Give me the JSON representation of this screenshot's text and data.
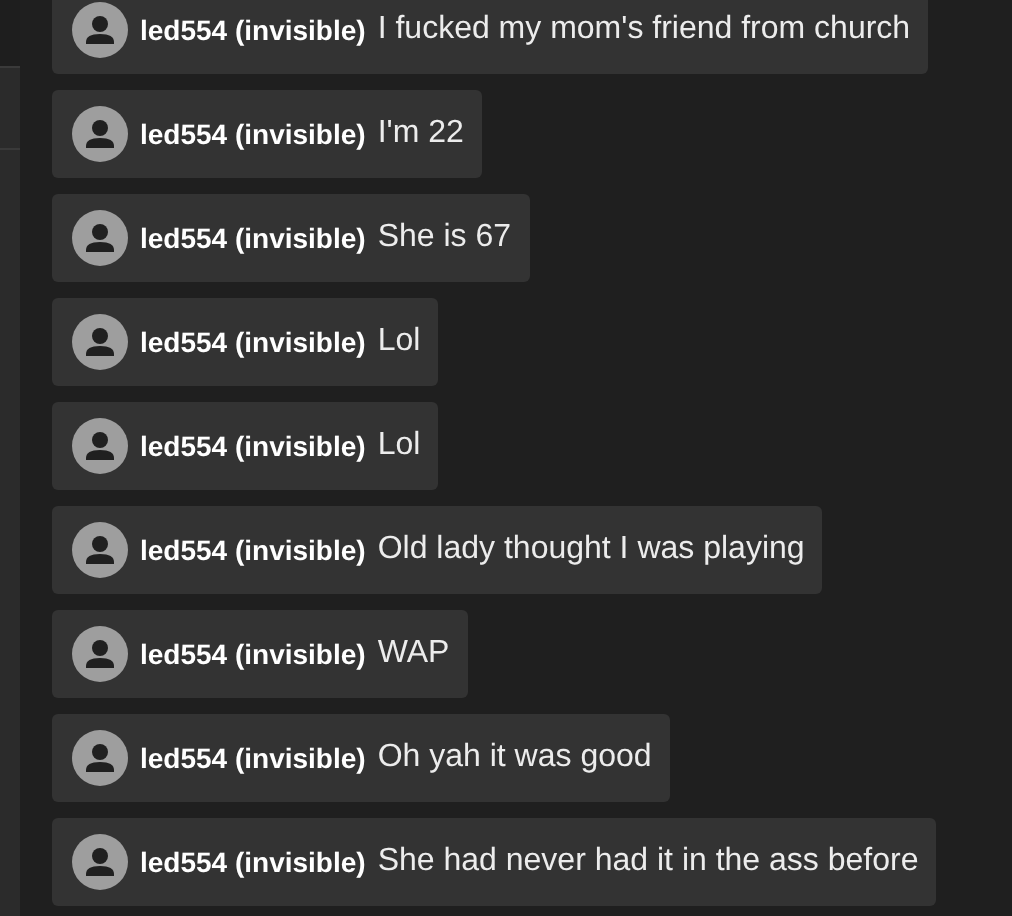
{
  "messages": [
    {
      "username": "led554 (invisible)",
      "text": "I fucked my mom's friend from church"
    },
    {
      "username": "led554 (invisible)",
      "text": "I'm 22"
    },
    {
      "username": "led554 (invisible)",
      "text": "She is 67"
    },
    {
      "username": "led554 (invisible)",
      "text": "Lol"
    },
    {
      "username": "led554 (invisible)",
      "text": "Lol"
    },
    {
      "username": "led554 (invisible)",
      "text": "Old lady thought I was playing"
    },
    {
      "username": "led554 (invisible)",
      "text": "WAP"
    },
    {
      "username": "led554 (invisible)",
      "text": "Oh yah it was good"
    },
    {
      "username": "led554 (invisible)",
      "text": "She had never had it in the ass before"
    }
  ]
}
